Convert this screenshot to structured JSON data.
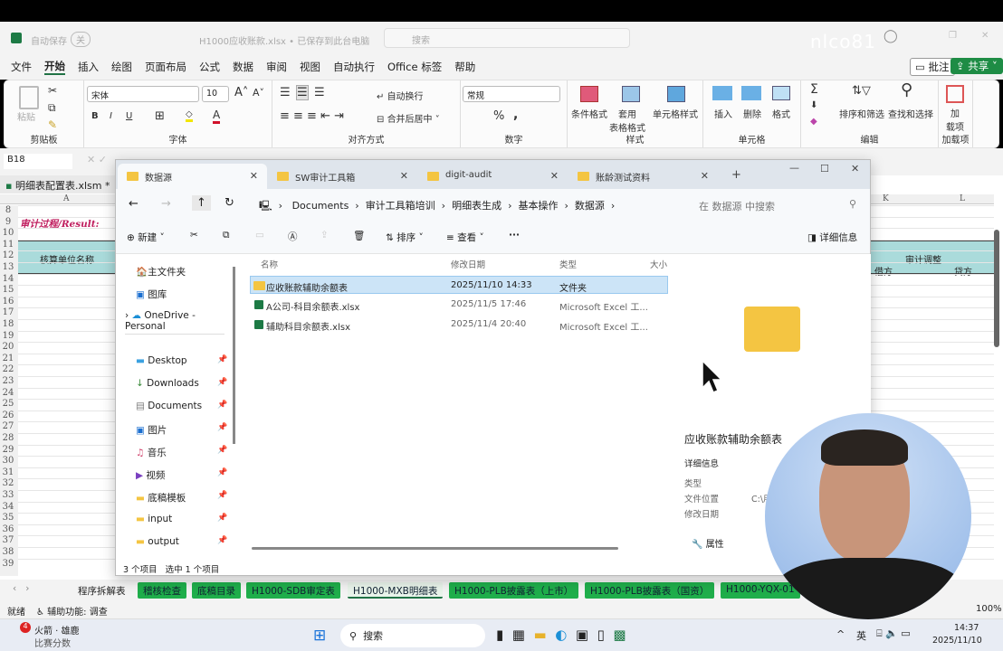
{
  "excel": {
    "titlebar": {
      "autosave": "自动保存",
      "autosave_state": "关",
      "doc_title": "H1000应收账款.xlsx • 已保存到此台电脑",
      "search": "搜索",
      "watermark": "nlco81"
    },
    "menu": [
      "文件",
      "开始",
      "插入",
      "绘图",
      "页面布局",
      "公式",
      "数据",
      "审阅",
      "视图",
      "自动执行",
      "Office 标签",
      "帮助"
    ],
    "comment_btn": "批注",
    "share_btn": "共享",
    "ribbon": {
      "clipboard": {
        "paste": "粘贴",
        "label": "剪贴板"
      },
      "font": {
        "name": "宋体",
        "size": "10",
        "label": "字体",
        "bold": "B",
        "italic": "I",
        "underline": "U"
      },
      "align": {
        "wrap": "自动换行",
        "merge": "合并后居中",
        "label": "对齐方式"
      },
      "number": {
        "format": "常规",
        "percent": "%",
        "comma": ",",
        "label": "数字"
      },
      "styles": {
        "cond": "条件格式",
        "table": "套用\n表格格式",
        "cell": "单元格样式",
        "label": "样式"
      },
      "cells": {
        "insert": "插入",
        "delete": "删除",
        "format": "格式",
        "label": "单元格"
      },
      "edit": {
        "sort": "排序和筛选",
        "find": "查找和选择",
        "label": "编辑"
      },
      "addins": {
        "btn": "加\n载项",
        "label": "加载项"
      }
    },
    "namebox": "B18",
    "workbook": "明细表配置表.xlsm *",
    "cols": {
      "a": "A",
      "k": "K",
      "l": "L"
    },
    "cells": {
      "result": "审计过程/Result:",
      "unit_name": "核算单位名称",
      "audit_adj": "审计调整",
      "debit": "借方",
      "credit": "贷方"
    },
    "rows": [
      "8",
      "9",
      "10",
      "11",
      "12",
      "13",
      "14",
      "15",
      "16",
      "17",
      "18",
      "19",
      "20",
      "21",
      "22",
      "23",
      "24",
      "25",
      "26",
      "27",
      "28",
      "29",
      "30",
      "31",
      "32",
      "33",
      "34",
      "35",
      "36",
      "37",
      "38",
      "39"
    ],
    "sheet_tabs": [
      "程序拆解表",
      "稽核检查",
      "底稿目录",
      "H1000-SDB审定表",
      "H1000-MXB明细表",
      "H1000-PLB披露表（上市）",
      "H1000-PLB披露表（国资）",
      "H1000-YQX-01"
    ],
    "active_tab": "H1000-MXB明细表",
    "status": {
      "ready": "就绪",
      "accessibility": "辅助功能: 调查",
      "zoom": "100%"
    }
  },
  "explorer": {
    "tabs": [
      "数据源",
      "SW审计工具箱",
      "digit-audit",
      "账龄测试资料"
    ],
    "breadcrumb": [
      "Documents",
      "审计工具箱培训",
      "明细表生成",
      "基本操作",
      "数据源"
    ],
    "search_placeholder": "在 数据源 中搜索",
    "toolbar": {
      "new": "新建",
      "sort": "排序",
      "view": "查看",
      "more": "···",
      "details": "详细信息"
    },
    "sidebar": [
      "主文件夹",
      "图库",
      "OneDrive - Personal",
      "Desktop",
      "Downloads",
      "Documents",
      "图片",
      "音乐",
      "视频",
      "底稿模板",
      "input",
      "output"
    ],
    "columns": [
      "名称",
      "修改日期",
      "类型",
      "大小"
    ],
    "files": [
      {
        "name": "应收账款辅助余额表",
        "date": "2025/11/10 14:33",
        "type": "文件夹"
      },
      {
        "name": "A公司-科目余额表.xlsx",
        "date": "2025/11/5 17:46",
        "type": "Microsoft Excel 工..."
      },
      {
        "name": "辅助科目余额表.xlsx",
        "date": "2025/11/4 20:40",
        "type": "Microsoft Excel 工..."
      }
    ],
    "details": {
      "title": "应收账款辅助余额表",
      "section": "详细信息",
      "type": "类型",
      "location": "文件位置",
      "location_val": "C:\\用",
      "modified": "修改日期",
      "properties": "属性"
    },
    "statusbar": {
      "count": "3 个项目",
      "selected": "选中 1 个项目"
    }
  },
  "taskbar": {
    "notif_count": "4",
    "news_title": "火箭 · 雄鹿",
    "news_sub": "比赛分数",
    "search": "搜索",
    "ime": "英",
    "time": "14:37",
    "date": "2025/11/10"
  }
}
